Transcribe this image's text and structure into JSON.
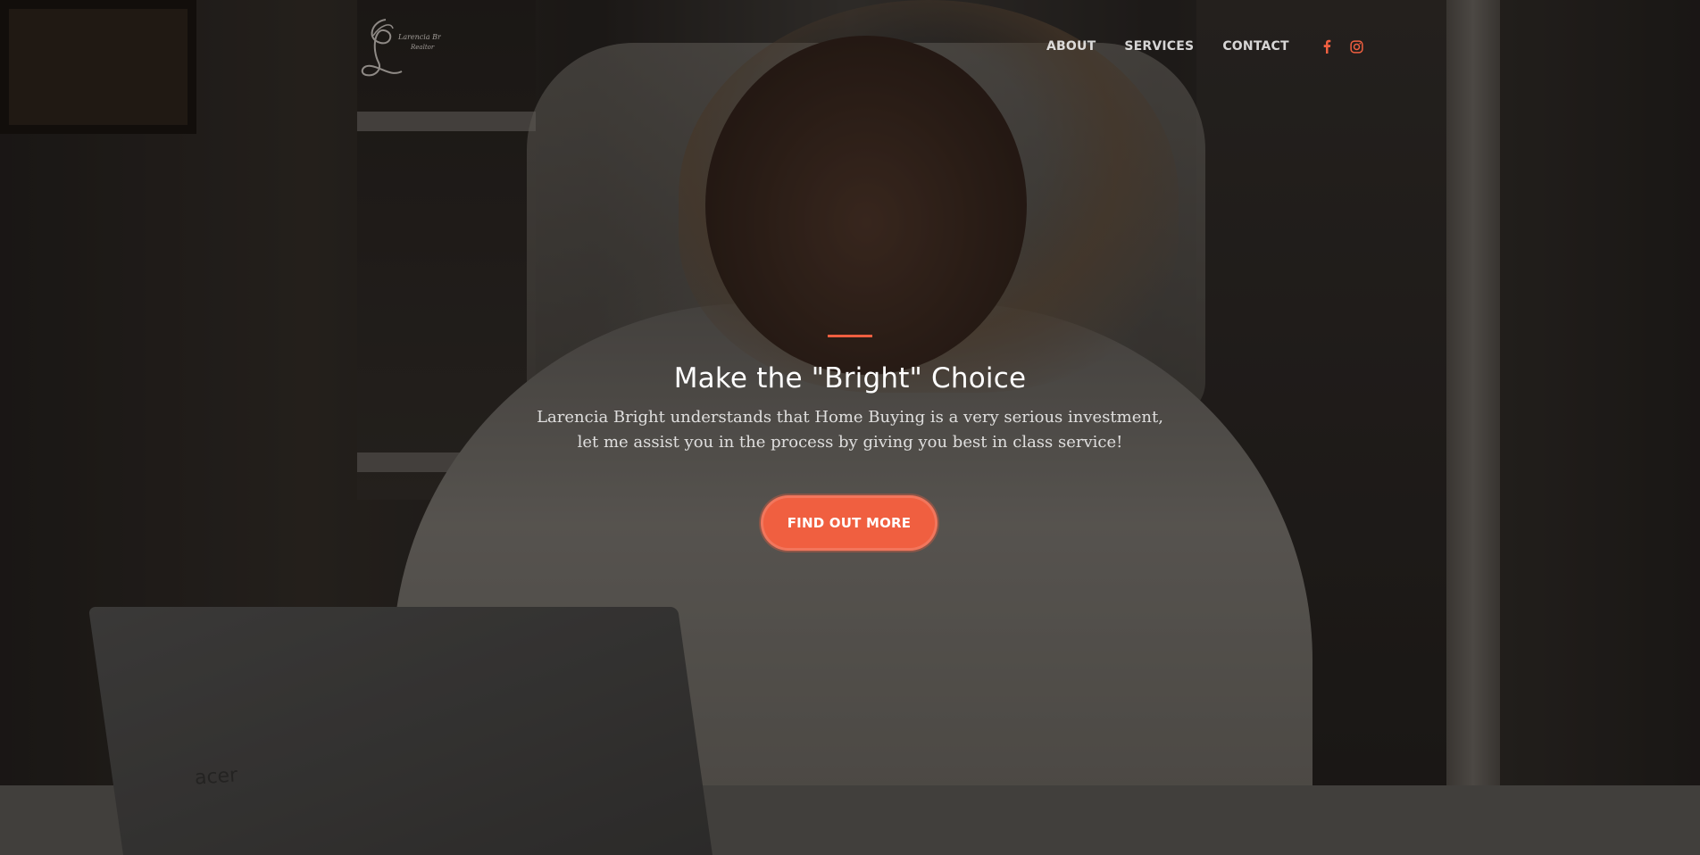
{
  "brand": {
    "logo_icon": "cursive-l-monogram-logo",
    "logo_text_line1": "Larencia Bright",
    "logo_text_line2": "Realtor"
  },
  "nav": {
    "links": [
      {
        "label": "ABOUT"
      },
      {
        "label": "SERVICES"
      },
      {
        "label": "CONTACT"
      }
    ],
    "social": [
      {
        "icon": "facebook-icon"
      },
      {
        "icon": "instagram-icon"
      }
    ]
  },
  "hero": {
    "title": "Make the \"Bright\" Choice",
    "lead": "Larencia Bright understands that Home Buying is a very serious investment, let me assist you in the process by giving you best in class service!",
    "cta_label": "FIND OUT MORE"
  },
  "background": {
    "laptop_brand": "acer"
  },
  "colors": {
    "accent": "#f05f40",
    "text": "#ffffff",
    "nav_text": "#d9d9d9"
  }
}
